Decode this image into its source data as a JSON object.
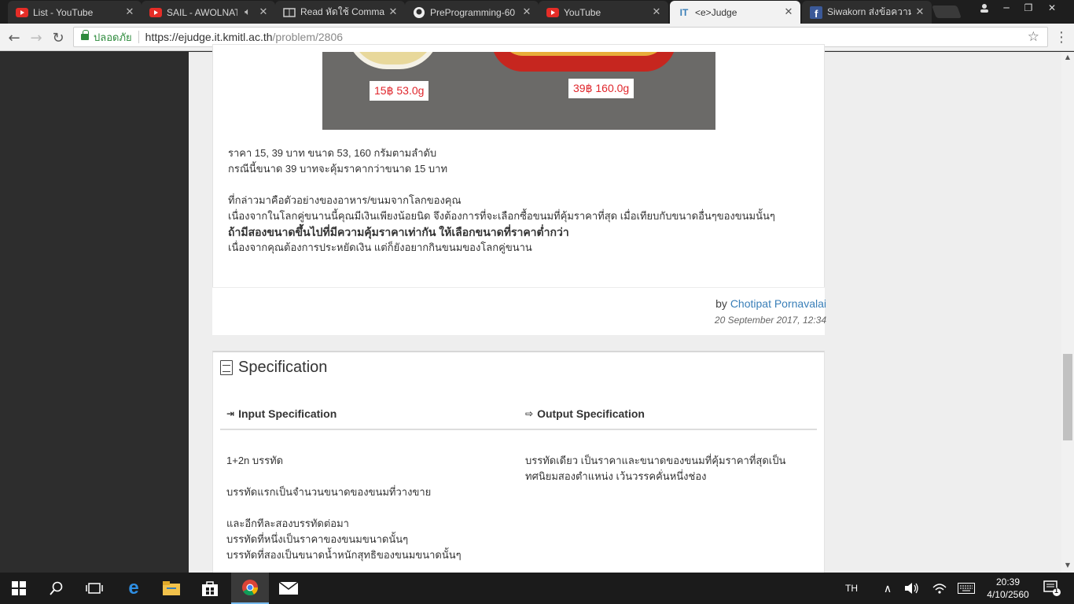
{
  "browser": {
    "tabs": [
      {
        "title": "List - YouTube",
        "icon": "youtube-icon"
      },
      {
        "title": "SAIL - AWOLNATION",
        "icon": "youtube-icon"
      },
      {
        "title": "Read หัดใช้ Command Line",
        "icon": "read-mode-icon"
      },
      {
        "title": "PreProgramming-60",
        "icon": "github-icon"
      },
      {
        "title": "YouTube",
        "icon": "youtube-icon"
      },
      {
        "title": "<e>Judge",
        "icon": "ejudge-icon",
        "active": true
      },
      {
        "title": "Siwakorn ส่งข้อความถึงคุณ",
        "icon": "facebook-icon"
      }
    ],
    "secure_label": "ปลอดภัย",
    "url_scheme_host": "https://ejudge.it.kmitl.ac.th",
    "url_path": "/problem/2806"
  },
  "problem": {
    "tag_small": "15฿ 53.0g",
    "tag_large": "39฿ 160.0g",
    "paragraphs": [
      "ราคา 15, 39 บาท ขนาด 53, 160 กรัมตามลำดับ",
      "กรณีนี้ขนาด 39 บาทจะคุ้มราคากว่าขนาด 15 บาท",
      "ที่กล่าวมาคือตัวอย่างของอาหาร/ขนมจากโลกของคุณ",
      "เนื่องจากในโลกคู่ขนานนี้คุณมีเงินเพียงน้อยนิด จึงต้องการที่จะเลือกซื้อขนมที่คุ้มราคาที่สุด เมื่อเทียบกับขนาดอื่นๆของขนมนั้นๆ",
      "ถ้ามีสองขนาดขึ้นไปที่มีความคุ้มราคาเท่ากัน ให้เลือกขนาดที่ราคาต่ำกว่า",
      "เนื่องจากคุณต้องการประหยัดเงิน แต่ก็ยังอยากกินขนมของโลกคู่ขนาน"
    ],
    "by_label": "by",
    "author": "Chotipat Pornavalai",
    "date": "20 September 2017, 12:34"
  },
  "spec": {
    "title": "Specification",
    "input_heading": "Input Specification",
    "output_heading": "Output Specification",
    "input_lines": [
      "1+2n บรรทัด",
      "บรรทัดแรกเป็นจำนวนขนาดของขนมที่วางขาย",
      "และอีกทีละสองบรรทัดต่อมา",
      "บรรทัดที่หนึ่งเป็นราคาของขนมขนาดนั้นๆ",
      "บรรทัดที่สองเป็นขนาดน้ำหนักสุทธิของขนมขนาดนั้นๆ"
    ],
    "output_lines": [
      "บรรทัดเดียว เป็นราคาและขนาดของขนมที่คุ้มราคาที่สุดเป็น",
      "ทศนิยมสองตำแหน่ง เว้นวรรคคั่นหนึ่งช่อง"
    ]
  },
  "taskbar": {
    "lang": "TH",
    "time": "20:39",
    "date": "4/10/2560",
    "notifications": "1"
  },
  "colors": {
    "accent": "#3a7fb8",
    "secure": "#2e8b3d",
    "price_tag": "#e0262c"
  }
}
